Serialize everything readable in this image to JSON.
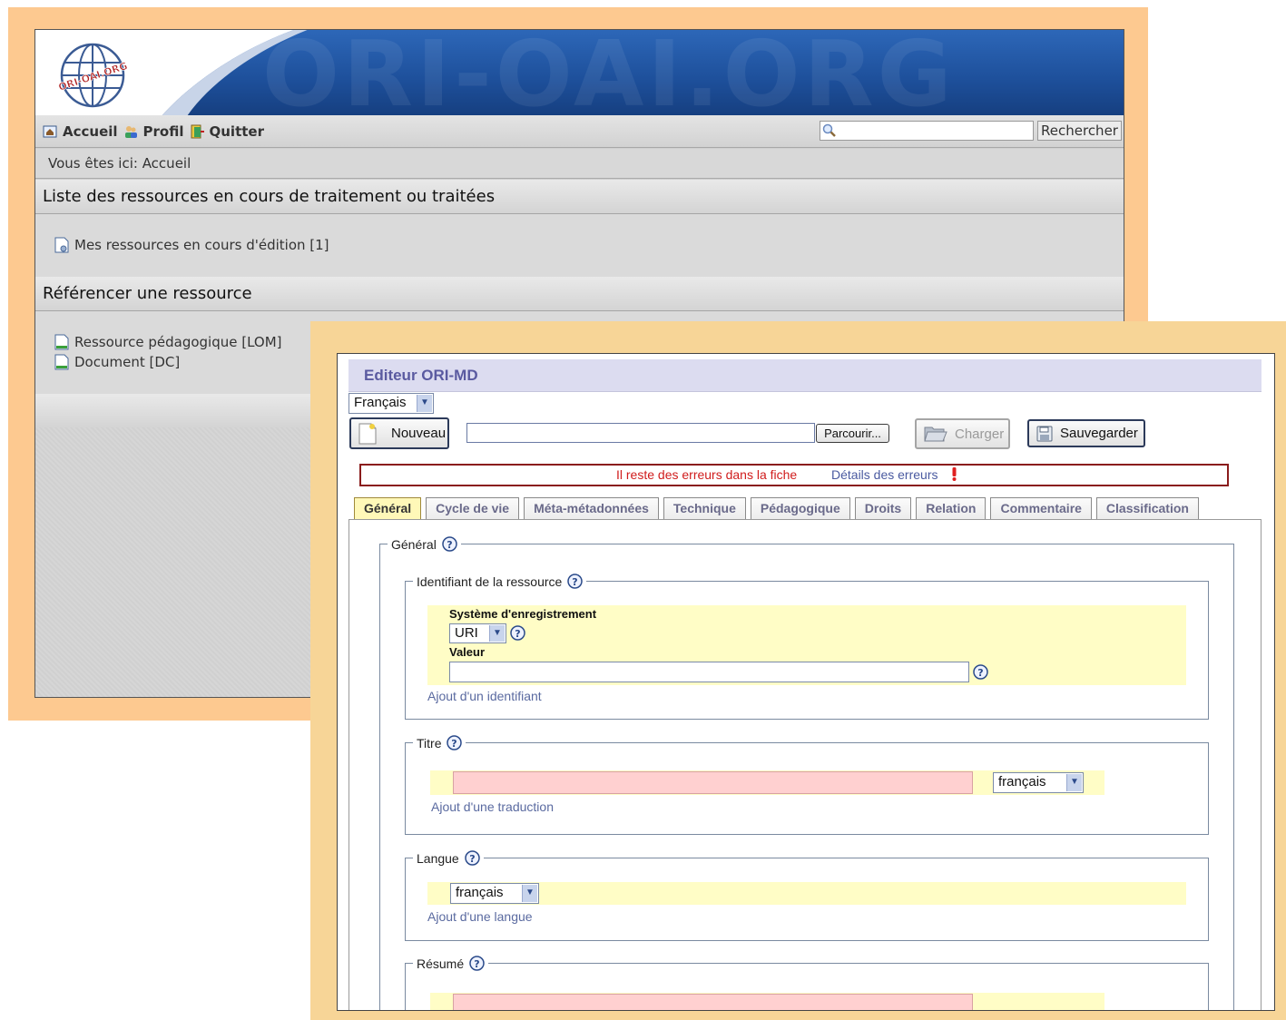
{
  "back": {
    "banner": {
      "logo_text": "ORI-OAI.ORG",
      "watermark": "ORI-OAI.ORG"
    },
    "menu": [
      {
        "label": "Accueil",
        "icon": "home-icon"
      },
      {
        "label": "Profil",
        "icon": "users-icon"
      },
      {
        "label": "Quitter",
        "icon": "exit-door-icon"
      }
    ],
    "search": {
      "value": "",
      "button_label": "Rechercher"
    },
    "breadcrumb": "Vous êtes ici: Accueil",
    "sections": [
      {
        "title": "Liste des ressources en cours de traitement ou traitées",
        "links": [
          {
            "label": "Mes ressources en cours d'édition  [1]",
            "icon": "document-gear-icon"
          }
        ]
      },
      {
        "title": "Référencer une ressource",
        "links": [
          {
            "label": "Ressource pédagogique [LOM]",
            "icon": "document-icon"
          },
          {
            "label": "Document [DC]",
            "icon": "document-icon"
          }
        ]
      }
    ]
  },
  "editor": {
    "title": "Editeur ORI-MD",
    "ui_language": "Français",
    "toolbar": {
      "new_label": "Nouveau",
      "browse_label": "Parcourir...",
      "file_value": "",
      "load_label": "Charger",
      "save_label": "Sauvegarder"
    },
    "error_bar": {
      "message": "Il reste des erreurs dans la fiche",
      "details_link": "Détails des erreurs",
      "color": "#d01c1c"
    },
    "tabs": [
      {
        "label": "Général",
        "active": true
      },
      {
        "label": "Cycle de vie",
        "active": false
      },
      {
        "label": "Méta-métadonnées",
        "active": false
      },
      {
        "label": "Technique",
        "active": false
      },
      {
        "label": "Pédagogique",
        "active": false
      },
      {
        "label": "Droits",
        "active": false
      },
      {
        "label": "Relation",
        "active": false
      },
      {
        "label": "Commentaire",
        "active": false
      },
      {
        "label": "Classification",
        "active": false
      }
    ],
    "general": {
      "legend": "Général",
      "identifier": {
        "legend": "Identifiant de la ressource",
        "catalog_label": "Système d'enregistrement",
        "catalog_value": "URI",
        "value_label": "Valeur",
        "value": "",
        "add_link": "Ajout d'un identifiant"
      },
      "title": {
        "legend": "Titre",
        "value": "",
        "language": "français",
        "add_link": "Ajout d'une traduction"
      },
      "language": {
        "legend": "Langue",
        "value": "français",
        "add_link": "Ajout d'une langue"
      },
      "summary": {
        "legend": "Résumé",
        "value": ""
      }
    }
  }
}
